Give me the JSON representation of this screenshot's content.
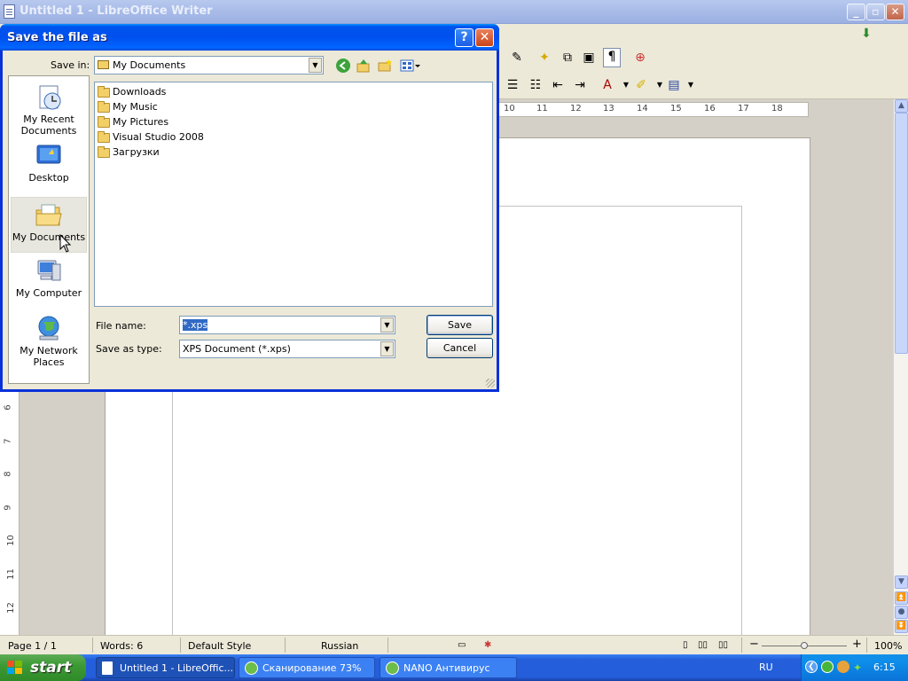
{
  "app": {
    "title": "Untitled 1 - LibreOffice Writer",
    "ruler_numbers": [
      "10",
      "11",
      "12",
      "13",
      "14",
      "15",
      "16",
      "17",
      "18"
    ],
    "vruler_numbers": [
      "6",
      "7",
      "8",
      "9",
      "10",
      "11",
      "12"
    ]
  },
  "statusbar": {
    "page": "Page 1 / 1",
    "words": "Words: 6",
    "style": "Default Style",
    "language": "Russian",
    "zoom": "100%",
    "zoom_level": 1.0
  },
  "dialog": {
    "title": "Save the file as",
    "save_in_label": "Save in:",
    "save_in_value": "My Documents",
    "places": [
      {
        "label": "My Recent Documents",
        "icon": "recent-documents-icon"
      },
      {
        "label": "Desktop",
        "icon": "desktop-icon"
      },
      {
        "label": "My Documents",
        "icon": "my-documents-icon",
        "selected": true
      },
      {
        "label": "My Computer",
        "icon": "my-computer-icon"
      },
      {
        "label": "My Network Places",
        "icon": "network-places-icon"
      }
    ],
    "files": [
      "Downloads",
      "My Music",
      "My Pictures",
      "Visual Studio 2008",
      "Загрузки"
    ],
    "file_name_label": "File name:",
    "file_name_value": "*.xps",
    "save_type_label": "Save as type:",
    "save_type_value": "XPS Document (*.xps)",
    "save_button": "Save",
    "cancel_button": "Cancel",
    "help_button": "?",
    "close_button": "✕"
  },
  "taskbar": {
    "start": "start",
    "tasks": [
      {
        "label": "Untitled 1 - LibreOffic...",
        "active": true
      },
      {
        "label": "Сканирование 73%",
        "active": false
      },
      {
        "label": "NANO Антивирус",
        "active": false
      }
    ],
    "language": "RU",
    "clock": "6:15"
  },
  "colors": {
    "dialog_title": "#0053ee",
    "selection": "#316ac5",
    "taskbar": "#245edb",
    "start_button": "#3c9a34"
  }
}
